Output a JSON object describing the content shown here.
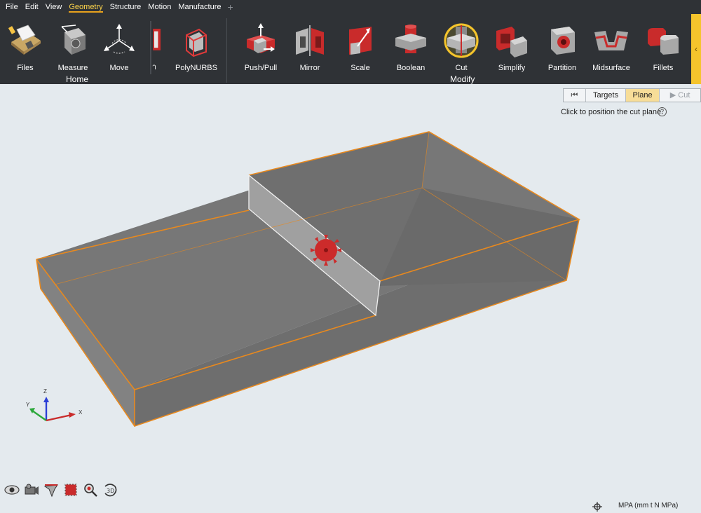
{
  "menu": {
    "items": [
      "File",
      "Edit",
      "View",
      "Geometry",
      "Structure",
      "Motion",
      "Manufacture"
    ],
    "active_index": 3,
    "add_symbol": "+"
  },
  "ribbon": {
    "home_group_label": "Home",
    "modify_group_label": "Modify",
    "home_buttons": [
      "Files",
      "Measure",
      "Move"
    ],
    "partial_label": "า",
    "polynurbs_label": "PolyNURBS",
    "modify_buttons": [
      "Push/Pull",
      "Mirror",
      "Scale",
      "Boolean",
      "Cut",
      "Simplify",
      "Partition",
      "Midsurface",
      "Fillets"
    ],
    "active_tool": "Cut",
    "collapse_symbol": "‹"
  },
  "guide_bar": {
    "first_symbol": "⏮",
    "targets": "Targets",
    "plane": "Plane",
    "cut": "Cut",
    "cut_symbol": "▶"
  },
  "hint": {
    "text": "Click to position the cut plane.",
    "help_symbol": "?"
  },
  "triad": {
    "z": "Z",
    "y": "Y",
    "x": "X"
  },
  "status": {
    "units": "MPA (mm t N MPa)"
  },
  "colors": {
    "ribbon_bg": "#2f3236",
    "viewport_bg": "#e4eaee",
    "part_gray": "#7d7d7d",
    "edge_orange": "#e8891e",
    "cut_plane": "#9c9c9c",
    "saw_red": "#cc2b2b",
    "highlight": "#f5c42c"
  }
}
